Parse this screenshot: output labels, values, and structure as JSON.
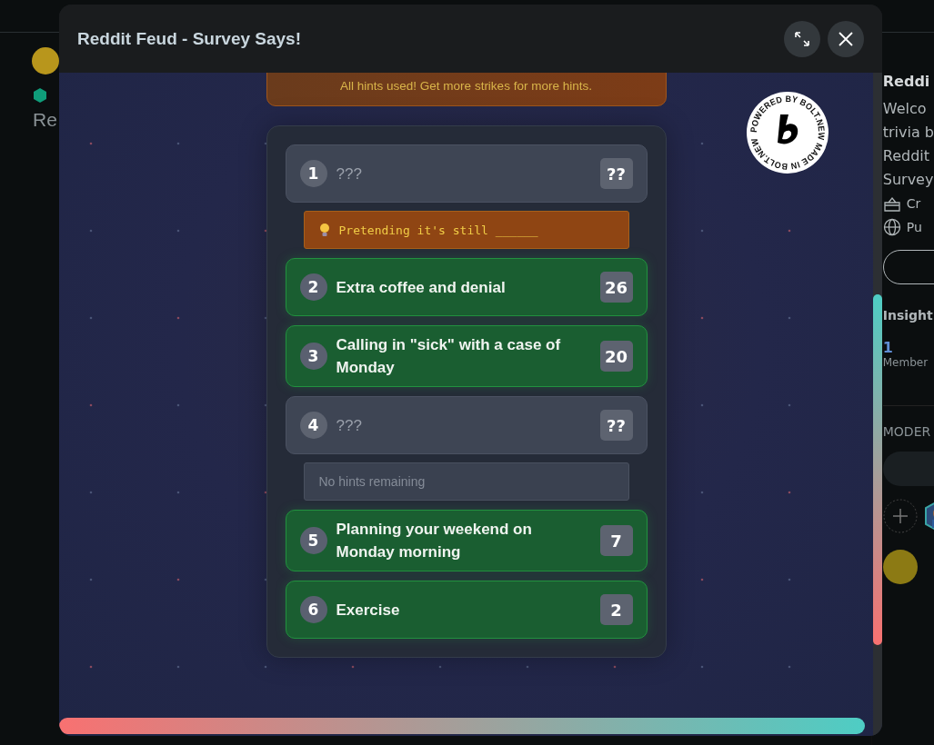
{
  "background_page": {
    "left_title": "Re",
    "sidebar": {
      "title": "Reddi",
      "description_lines": [
        "Welco",
        "trivia b",
        "Reddit",
        "Survey"
      ],
      "info": [
        {
          "kind": "cake",
          "text": "Cr"
        },
        {
          "kind": "globe",
          "text": "Pu"
        }
      ],
      "insights_heading": "Insight",
      "member_count": "1",
      "member_label": "Member",
      "moderators_heading": "MODER"
    }
  },
  "modal": {
    "title": "Reddit Feud - Survey Says!",
    "notice": "All hints used! Get more strikes for more hints.",
    "badge_text": "POWERED BY BOLT.NEW MADE IN BOLT.NEW ",
    "answers": [
      {
        "number": "1",
        "text": "???",
        "points": "??",
        "revealed": false,
        "hint": {
          "kind": "hint",
          "text": "Pretending it's still ______"
        }
      },
      {
        "number": "2",
        "text": "Extra coffee and denial",
        "points": "26",
        "revealed": true
      },
      {
        "number": "3",
        "text": "Calling in \"sick\" with a case of Monday",
        "points": "20",
        "revealed": true
      },
      {
        "number": "4",
        "text": "???",
        "points": "??",
        "revealed": false,
        "hint": {
          "kind": "empty",
          "text": "No hints remaining"
        }
      },
      {
        "number": "5",
        "text": "Planning your weekend on Monday morning",
        "points": "7",
        "revealed": true
      },
      {
        "number": "6",
        "text": "Exercise",
        "points": "2",
        "revealed": true
      }
    ]
  }
}
